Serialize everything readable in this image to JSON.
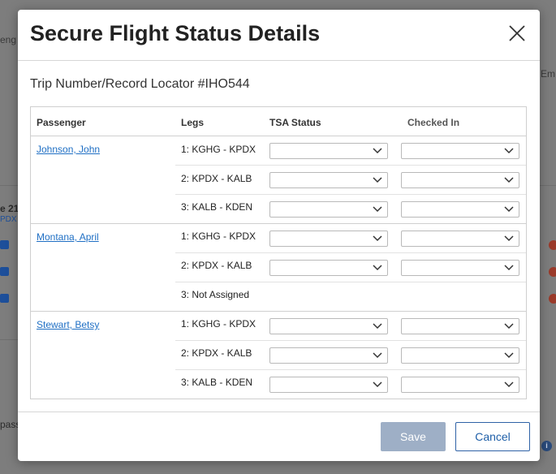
{
  "background": {
    "frag_top": "eng",
    "frag_right": "Em",
    "frag_mid_a": "e 21",
    "frag_mid_b": "PDX",
    "frag_bottom": "pass"
  },
  "dialog": {
    "title": "Secure Flight Status Details",
    "trip_label": "Trip Number/Record Locator #IHO544",
    "columns": {
      "passenger": "Passenger",
      "legs": "Legs",
      "tsa_status": "TSA Status",
      "checked_in": "Checked In"
    },
    "passengers": [
      {
        "name": "Johnson, John",
        "legs": [
          "1: KGHG - KPDX",
          "2: KPDX - KALB",
          "3: KALB - KDEN"
        ]
      },
      {
        "name": "Montana, April",
        "legs": [
          "1: KGHG - KPDX",
          "2: KPDX - KALB",
          "3: Not Assigned"
        ]
      },
      {
        "name": "Stewart, Betsy",
        "legs": [
          "1: KGHG - KPDX",
          "2: KPDX - KALB",
          "3: KALB - KDEN"
        ]
      }
    ],
    "save_label": "Save",
    "cancel_label": "Cancel"
  },
  "colors": {
    "link": "#1f6fc4",
    "save_disabled": "#9eafc6",
    "cancel_border": "#2f62a6"
  }
}
